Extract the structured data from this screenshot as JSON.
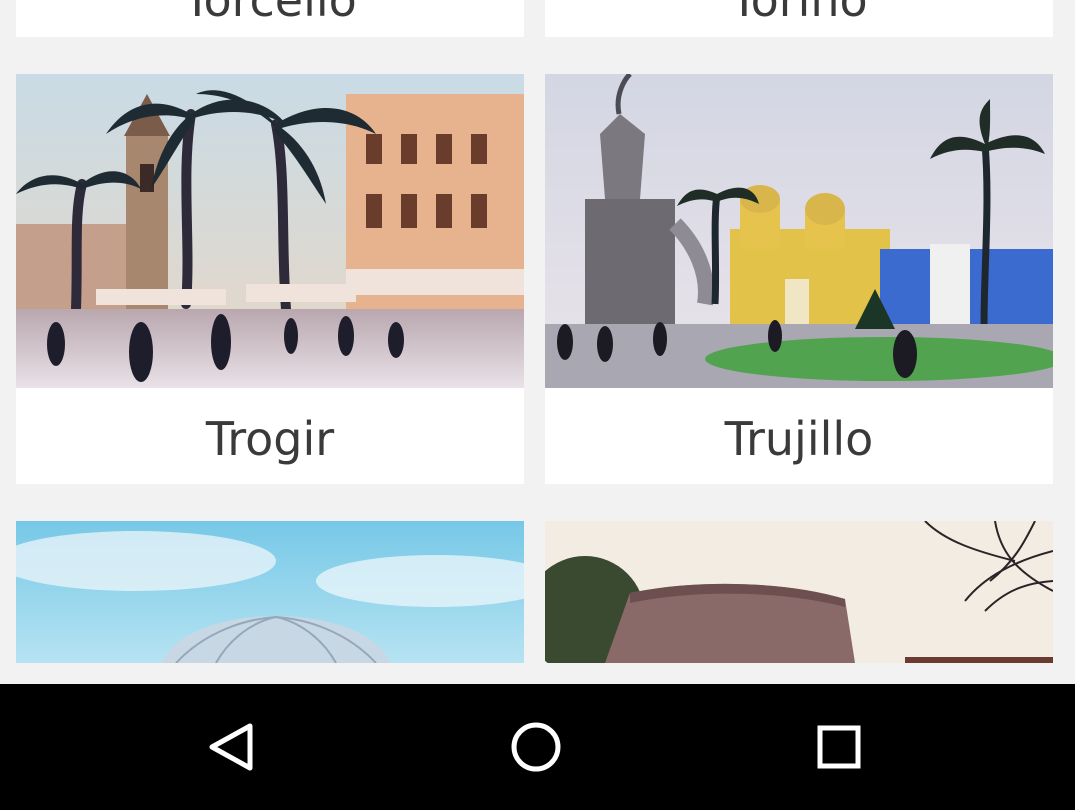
{
  "cities": {
    "row0": {
      "left": "Torcello",
      "right": "Torino"
    },
    "row1": {
      "left": "Trogir",
      "right": "Trujillo"
    }
  },
  "photos": {
    "trogir": "trogir-square-photo",
    "trujillo": "trujillo-plaza-photo",
    "row2_left": "dome-building-photo",
    "row2_right": "fortress-wall-photo"
  },
  "navbar": {
    "icons": [
      "back-icon",
      "home-icon",
      "recents-icon"
    ]
  },
  "colors": {
    "background": "#f2f2f2",
    "card": "#ffffff",
    "label": "#3a3a3a",
    "navbar": "#000000"
  }
}
